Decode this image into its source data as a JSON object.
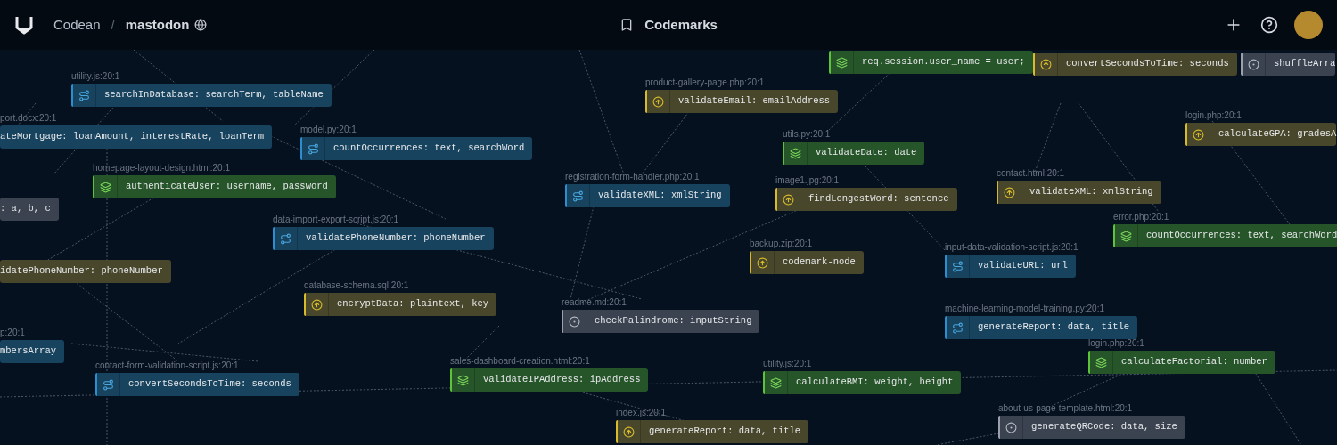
{
  "header": {
    "org": "Codean",
    "separator": "/",
    "project": "mastodon",
    "title": "Codemarks"
  },
  "nodes": [
    {
      "file": "utility.js:20:1",
      "text": "searchInDatabase: searchTerm, tableName",
      "kind": "route"
    },
    {
      "file": "port.docx:20:1",
      "text": "ateMortgage: loanAmount, interestRate, loanTerm",
      "kind": "route"
    },
    {
      "file": "model.py:20:1",
      "text": "countOccurrences: text, searchWord",
      "kind": "route"
    },
    {
      "file": "homepage-layout-design.html:20:1",
      "text": "authenticateUser: username, password",
      "kind": "layers"
    },
    {
      "text": ": a, b, c",
      "kind": "dot"
    },
    {
      "file": "product-gallery-page.php:20:1",
      "text": "validateEmail: emailAddress",
      "kind": "arrow"
    },
    {
      "text": "req.session.user_name = user;",
      "kind": "layers"
    },
    {
      "text": "convertSecondsToTime: seconds",
      "kind": "arrow"
    },
    {
      "text": "shuffleArra",
      "kind": "dot"
    },
    {
      "file": "utils.py:20:1",
      "text": "validateDate: date",
      "kind": "layers"
    },
    {
      "file": "registration-form-handler.php:20:1",
      "text": "validateXML: xmlString",
      "kind": "route"
    },
    {
      "file": "image1.jpg:20:1",
      "text": "findLongestWord: sentence",
      "kind": "arrow"
    },
    {
      "file": "login.php:20:1",
      "text": "calculateGPA: gradesA",
      "kind": "arrow"
    },
    {
      "file": "contact.html:20:1",
      "text": "validateXML: xmlString",
      "kind": "arrow"
    },
    {
      "file": "data-import-export-script.js:20:1",
      "text": "validatePhoneNumber: phoneNumber",
      "kind": "route"
    },
    {
      "file": "error.php:20:1",
      "text": "countOccurrences: text, searchWord",
      "kind": "layers"
    },
    {
      "text": "idatePhoneNumber: phoneNumber",
      "kind": "arrow"
    },
    {
      "file": "backup.zip:20:1",
      "text": "codemark-node",
      "kind": "arrow"
    },
    {
      "file": "input-data-validation-script.js:20:1",
      "text": "validateURL: url",
      "kind": "route"
    },
    {
      "file": "database-schema.sql:20:1",
      "text": "encryptData: plaintext, key",
      "kind": "arrow"
    },
    {
      "file": "readme.md:20:1",
      "text": "checkPalindrome: inputString",
      "kind": "dot"
    },
    {
      "file": "machine-learning-model-training.py:20:1",
      "text": "generateReport: data, title",
      "kind": "route"
    },
    {
      "file": "login.php:20:1",
      "text": "calculateFactorial: number",
      "kind": "layers"
    },
    {
      "file": "p:20:1",
      "text": "mbersArray",
      "kind": "route"
    },
    {
      "file": "contact-form-validation-script.js:20:1",
      "text": "convertSecondsToTime: seconds",
      "kind": "route"
    },
    {
      "file": "sales-dashboard-creation.html:20:1",
      "text": "validateIPAddress: ipAddress",
      "kind": "layers"
    },
    {
      "file": "utility.js:20:1",
      "text": "calculateBMI: weight, height",
      "kind": "layers"
    },
    {
      "file": "about-us-page-template.html:20:1",
      "text": "generateQRCode: data, size",
      "kind": "dot"
    },
    {
      "file": "index.js:20:1",
      "text": "generateReport: data, title",
      "kind": "arrow"
    }
  ]
}
